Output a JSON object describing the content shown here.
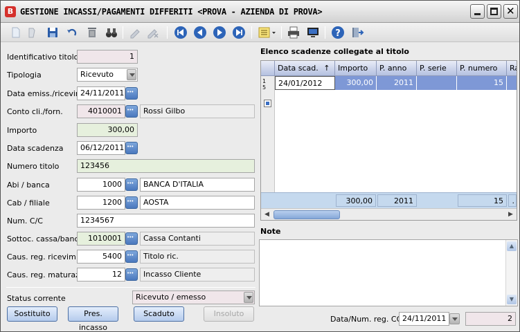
{
  "window": {
    "title": "GESTIONE INCASSI/PAGAMENTI DIFFERITI <PROVA - AZIENDA DI PROVA>"
  },
  "toolbar": {
    "icons": [
      "new-document-icon",
      "delete-doc-icon",
      "save-icon",
      "undo-icon",
      "trash-icon",
      "binoculars-icon",
      "edit-icon",
      "cancel-edit-icon",
      "first-record-icon",
      "previous-record-icon",
      "next-record-icon",
      "last-record-icon",
      "list-options-icon",
      "print-icon",
      "monitor-icon",
      "help-icon",
      "exit-icon"
    ]
  },
  "form": {
    "identificativo": {
      "label": "Identificativo titolo",
      "value": "1"
    },
    "tipologia": {
      "label": "Tipologia",
      "value": "Ricevuto"
    },
    "data_emiss": {
      "label": "Data emiss./ricevim.",
      "value": "24/11/2011"
    },
    "conto": {
      "label": "Conto cli./forn.",
      "code": "4010001",
      "desc": "Rossi Gilbo"
    },
    "importo": {
      "label": "Importo",
      "value": "300,00"
    },
    "data_scadenza": {
      "label": "Data scadenza",
      "value": "06/12/2011"
    },
    "numero_titolo": {
      "label": "Numero titolo",
      "value": "123456"
    },
    "abi": {
      "label": "Abi / banca",
      "code": "1000",
      "desc": "BANCA D'ITALIA"
    },
    "cab": {
      "label": "Cab / filiale",
      "code": "1200",
      "desc": "AOSTA"
    },
    "num_cc": {
      "label": "Num. C/C",
      "value": "1234567"
    },
    "sottoc": {
      "label": "Sottoc. cassa/banca",
      "code": "1010001",
      "desc": "Cassa Contanti"
    },
    "caus_ricevim": {
      "label": "Caus. reg. ricevim.",
      "code": "5400",
      "desc": "Titolo ric."
    },
    "caus_matur": {
      "label": "Caus. reg. maturaz.",
      "code": "12",
      "desc": "Incasso Cliente"
    },
    "status": {
      "label": "Status corrente",
      "value": "Ricevuto / emesso"
    }
  },
  "buttons": {
    "sostituito": "Sostituito",
    "pres_incasso": "Pres. incasso",
    "scaduto": "Scaduto",
    "insoluto": "Insoluto"
  },
  "grid": {
    "title": "Elenco scadenze collegate al titolo",
    "columns": [
      "Data scad.",
      "Importo",
      "P. anno",
      "P. serie",
      "P. numero",
      "Ra"
    ],
    "rows": [
      {
        "data_scad": "24/01/2012",
        "importo": "300,00",
        "p_anno": "2011",
        "p_serie": "",
        "p_numero": "15"
      }
    ],
    "row_indicator": "1",
    "row_indicator2": "5",
    "totals": {
      "importo": "300,00",
      "p_anno": "2011",
      "p_numero": "15",
      "ra": "."
    }
  },
  "notes": {
    "title": "Note",
    "value": ""
  },
  "footer": {
    "label": "Data/Num. reg. CG",
    "date": "24/11/2011",
    "num": "2"
  }
}
